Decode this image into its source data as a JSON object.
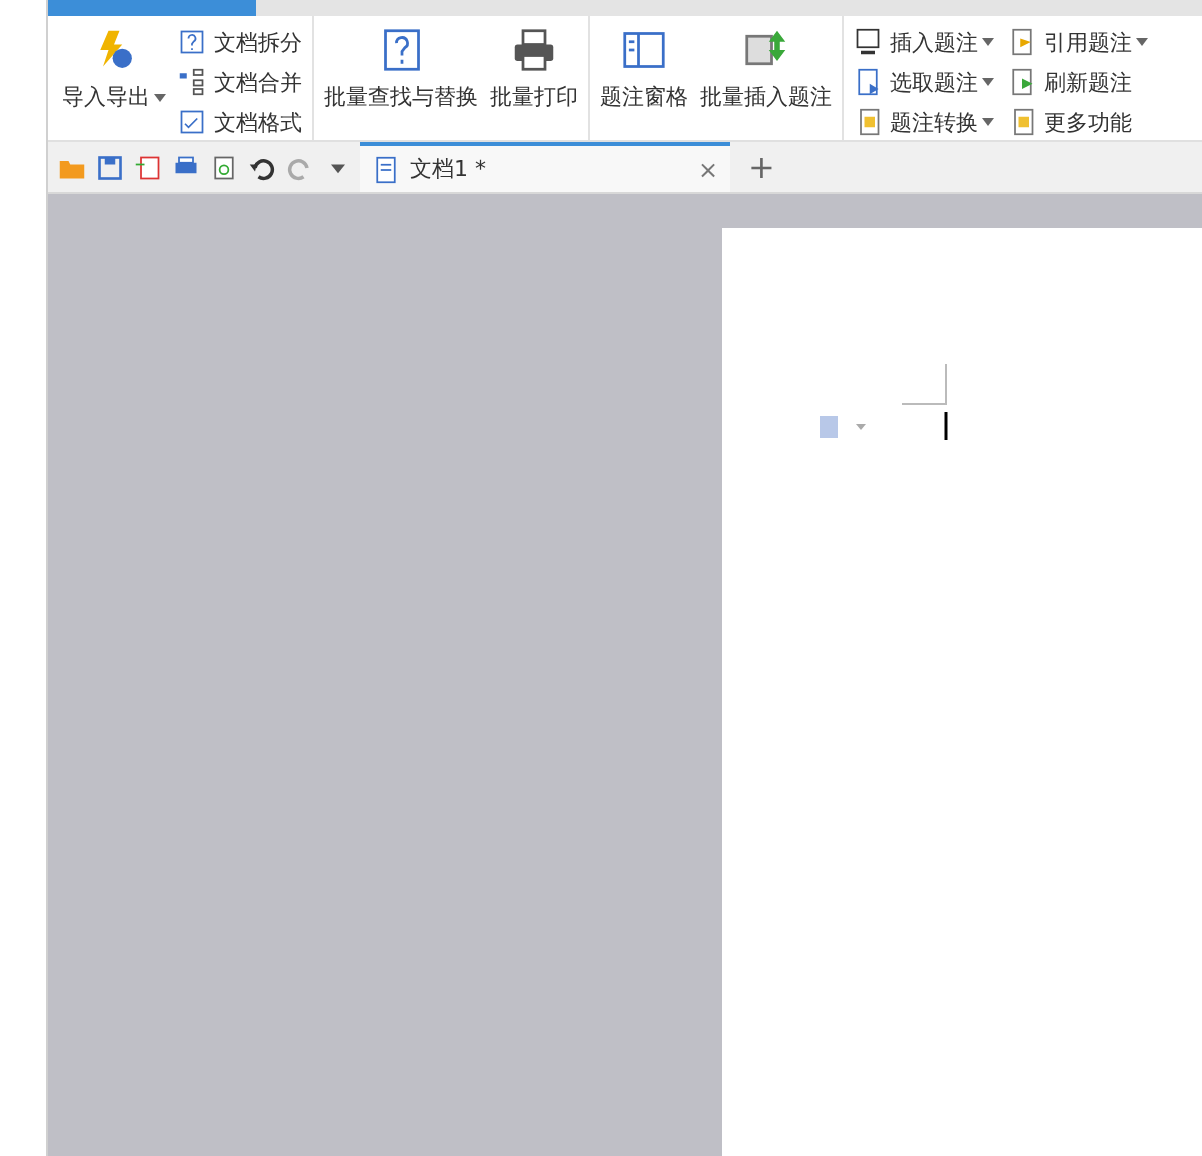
{
  "ribbon": {
    "groups": [
      {
        "items": [
          {
            "kind": "large",
            "label": "导入导出",
            "dropdown": true
          },
          {
            "kind": "small",
            "label": "文档拆分",
            "dropdown": false
          },
          {
            "kind": "small",
            "label": "文档合并",
            "dropdown": false
          },
          {
            "kind": "small",
            "label": "文档格式",
            "dropdown": false
          }
        ]
      },
      {
        "items": [
          {
            "kind": "large",
            "label": "批量查找与替换",
            "dropdown": false
          },
          {
            "kind": "large",
            "label": "批量打印",
            "dropdown": false
          }
        ]
      },
      {
        "items": [
          {
            "kind": "large",
            "label": "题注窗格",
            "dropdown": false
          },
          {
            "kind": "large",
            "label": "批量插入题注",
            "dropdown": false
          }
        ]
      },
      {
        "items": [
          {
            "kind": "grid",
            "label": "插入题注",
            "dropdown": true
          },
          {
            "kind": "grid",
            "label": "引用题注",
            "dropdown": true
          },
          {
            "kind": "grid",
            "label": "选取题注",
            "dropdown": true
          },
          {
            "kind": "grid",
            "label": "刷新题注",
            "dropdown": false
          },
          {
            "kind": "grid",
            "label": "题注转换",
            "dropdown": true
          },
          {
            "kind": "grid",
            "label": "更多功能",
            "dropdown": false
          }
        ]
      }
    ]
  },
  "doc_tabs": [
    {
      "label": "文档1 *",
      "selected": true,
      "close": "×"
    }
  ],
  "new_tab": "+"
}
